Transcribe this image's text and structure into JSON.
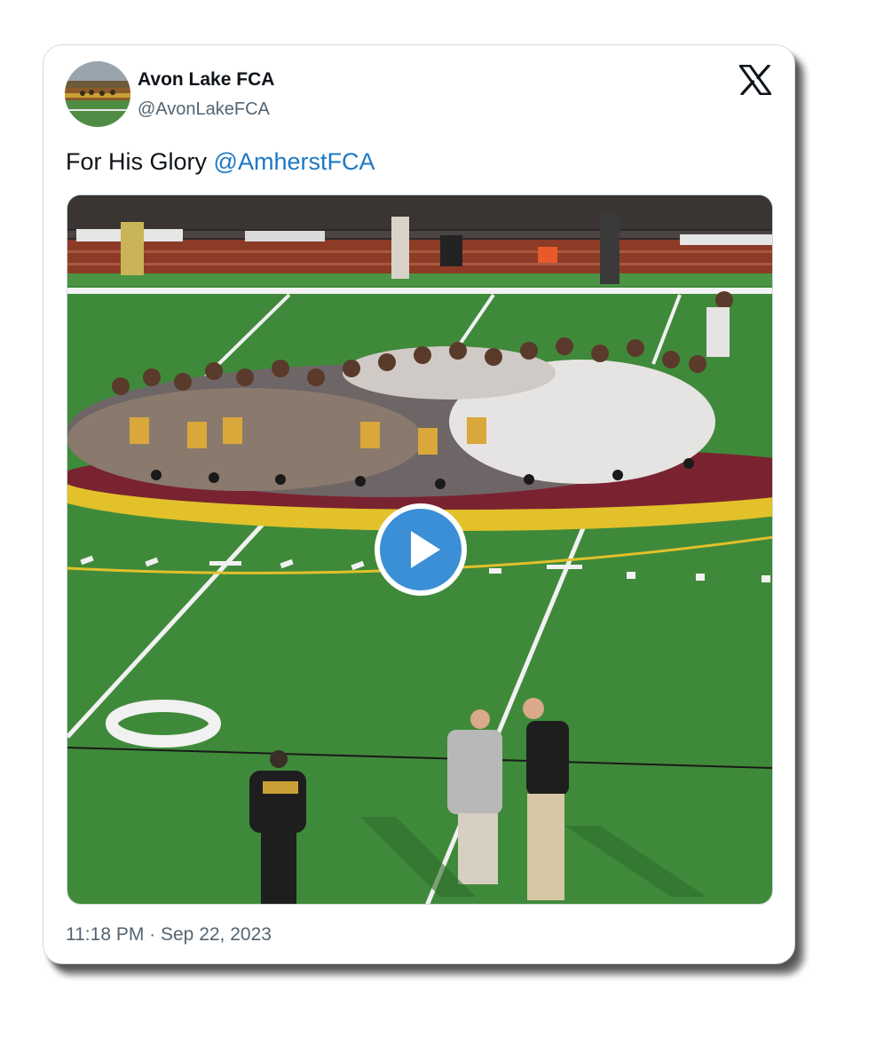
{
  "tweet": {
    "author": {
      "name": "Avon Lake FCA",
      "handle": "@AvonLakeFCA"
    },
    "text_prefix": "For His Glory",
    "mention": "@AmherstFCA",
    "timestamp": "11:18 PM · Sep 22, 2023"
  },
  "media": {
    "type": "video",
    "field_number": "0"
  },
  "icons": {
    "brand": "x-logo-icon",
    "play": "play-icon"
  },
  "colors": {
    "mention": "#1d78c4",
    "play_button": "#3b8fd6",
    "field_green": "#3f8a3a",
    "endzone_yellow": "#e2c12a",
    "endzone_maroon": "#7a2330"
  }
}
